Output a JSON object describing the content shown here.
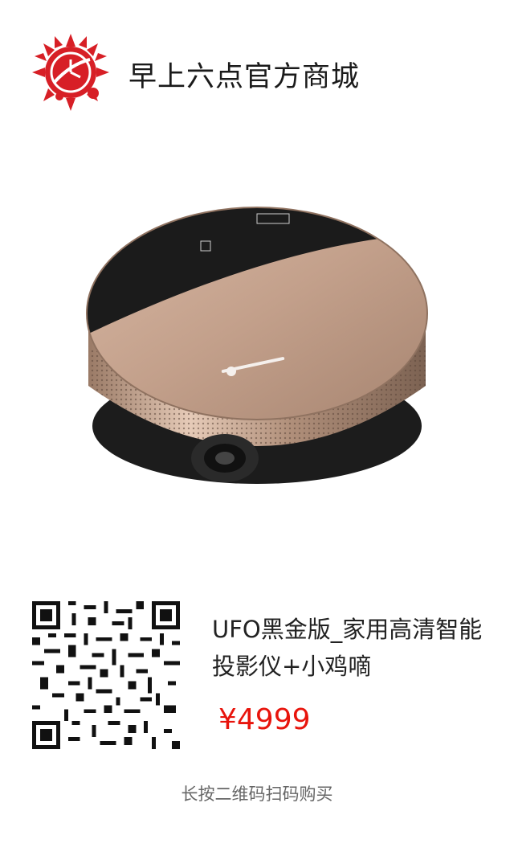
{
  "header": {
    "store_name": "早上六点官方商城",
    "logo_icon": "sun-clock-logo-icon",
    "brand_color": "#d71f26"
  },
  "product": {
    "image_icon": "projector-image",
    "title": "UFO黑金版_家用高清智能投影仪+小鸡嘀",
    "price": "¥4999",
    "price_color": "#e8140c"
  },
  "qr": {
    "icon": "qr-code-icon",
    "hint": "长按二维码扫码购买"
  }
}
